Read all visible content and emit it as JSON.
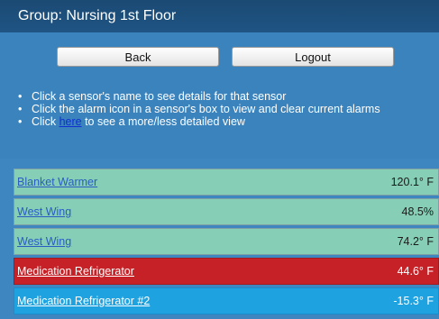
{
  "header": {
    "title": "Group: Nursing 1st Floor"
  },
  "buttons": {
    "back_label": "Back",
    "logout_label": "Logout"
  },
  "instructions": {
    "line1": "Click a sensor's name to see details for that sensor",
    "line2": "Click the alarm icon in a sensor's box to view and clear current alarms",
    "line3_before": "Click ",
    "line3_link": "here",
    "line3_after": " to see a more/less detailed view"
  },
  "sensors": [
    {
      "name": "Blanket Warmer",
      "value": "120.1° F",
      "status": "normal"
    },
    {
      "name": "West Wing",
      "value": "48.5%",
      "status": "normal"
    },
    {
      "name": "West Wing",
      "value": "74.2° F",
      "status": "normal"
    },
    {
      "name": "Medication Refrigerator",
      "value": "44.6° F",
      "status": "alarm-high"
    },
    {
      "name": "Medication Refrigerator #2",
      "value": "-15.3° F",
      "status": "alarm-low"
    }
  ],
  "colors": {
    "header_bg": "#1f5484",
    "panel_bg": "#3a83bd",
    "normal_row": "#86cfb6",
    "alarm_high_row": "#c62127",
    "alarm_low_row": "#1fa2e0"
  }
}
